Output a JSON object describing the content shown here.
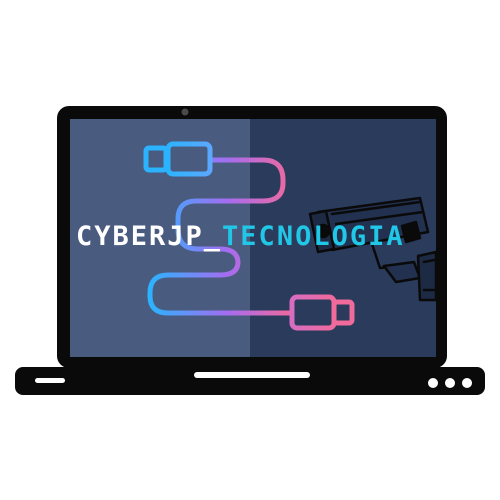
{
  "logo": {
    "brand_left": "CYBERJP_",
    "brand_right": "TECNOLOGIA"
  },
  "colors": {
    "laptop_frame": "#0a0a0a",
    "screen_left": "#4a5b80",
    "screen_right": "#2b3b5c",
    "cable_start": "#2bb3ff",
    "cable_mid": "#a66cf0",
    "cable_end": "#f06a9b",
    "text_white": "#ffffff",
    "text_cyan": "#21c7e6"
  },
  "icons": {
    "usb_connector_top": "usb-plug-icon",
    "usb_connector_bottom": "usb-plug-icon",
    "camera": "security-camera-icon"
  }
}
